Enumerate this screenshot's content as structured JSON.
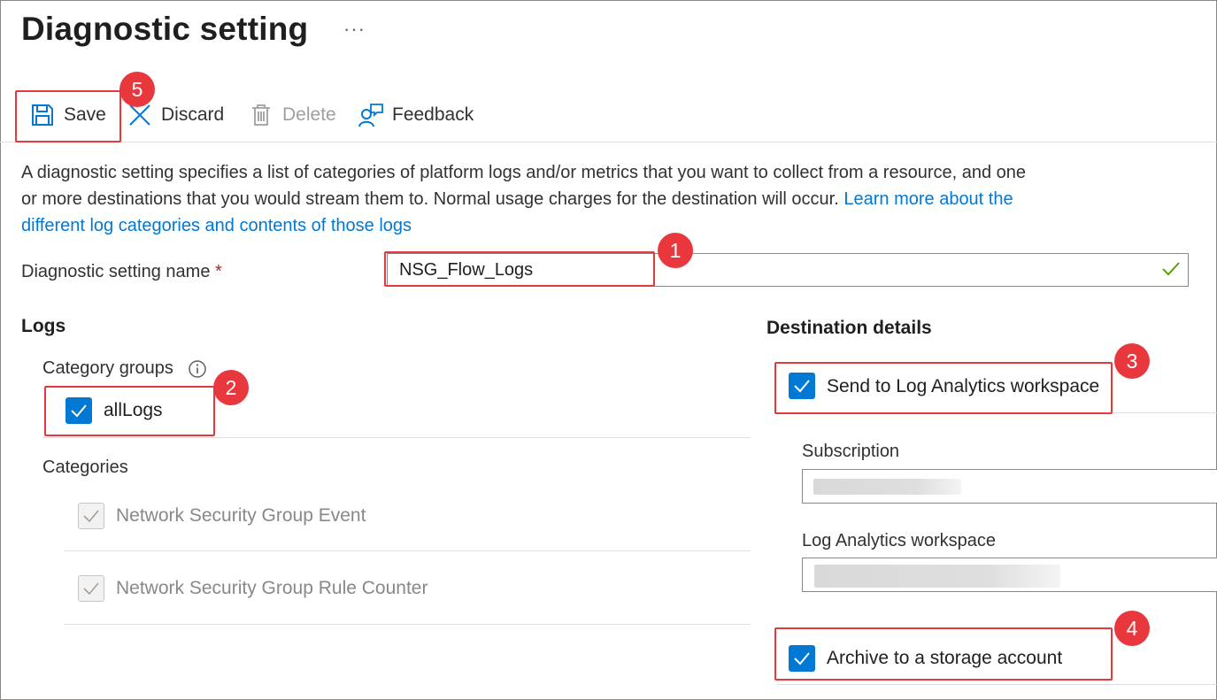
{
  "header": {
    "title": "Diagnostic setting",
    "more_label": "···"
  },
  "toolbar": {
    "save_label": "Save",
    "discard_label": "Discard",
    "delete_label": "Delete",
    "feedback_label": "Feedback"
  },
  "description": {
    "text": "A diagnostic setting specifies a list of categories of platform logs and/or metrics that you want to collect from a resource, and one or more destinations that you would stream them to. Normal usage charges for the destination will occur.",
    "link": "Learn more about the different log categories and contents of those logs"
  },
  "name_field": {
    "label": "Diagnostic setting name",
    "required_marker": "*",
    "value": "NSG_Flow_Logs"
  },
  "logs": {
    "heading": "Logs",
    "category_groups_label": "Category groups",
    "group": {
      "label": "allLogs",
      "checked": true
    },
    "categories_label": "Categories",
    "categories": [
      {
        "label": "Network Security Group Event",
        "checked": true,
        "disabled": true
      },
      {
        "label": "Network Security Group Rule Counter",
        "checked": true,
        "disabled": true
      }
    ]
  },
  "destination": {
    "heading": "Destination details",
    "log_analytics": {
      "label": "Send to Log Analytics workspace",
      "checked": true
    },
    "subscription_label": "Subscription",
    "workspace_label": "Log Analytics workspace",
    "archive": {
      "label": "Archive to a storage account",
      "checked": true
    }
  },
  "callouts": [
    "1",
    "2",
    "3",
    "4",
    "5"
  ],
  "colors": {
    "accent": "#0078d4",
    "callout": "#e8383d",
    "valid": "#57a300"
  }
}
